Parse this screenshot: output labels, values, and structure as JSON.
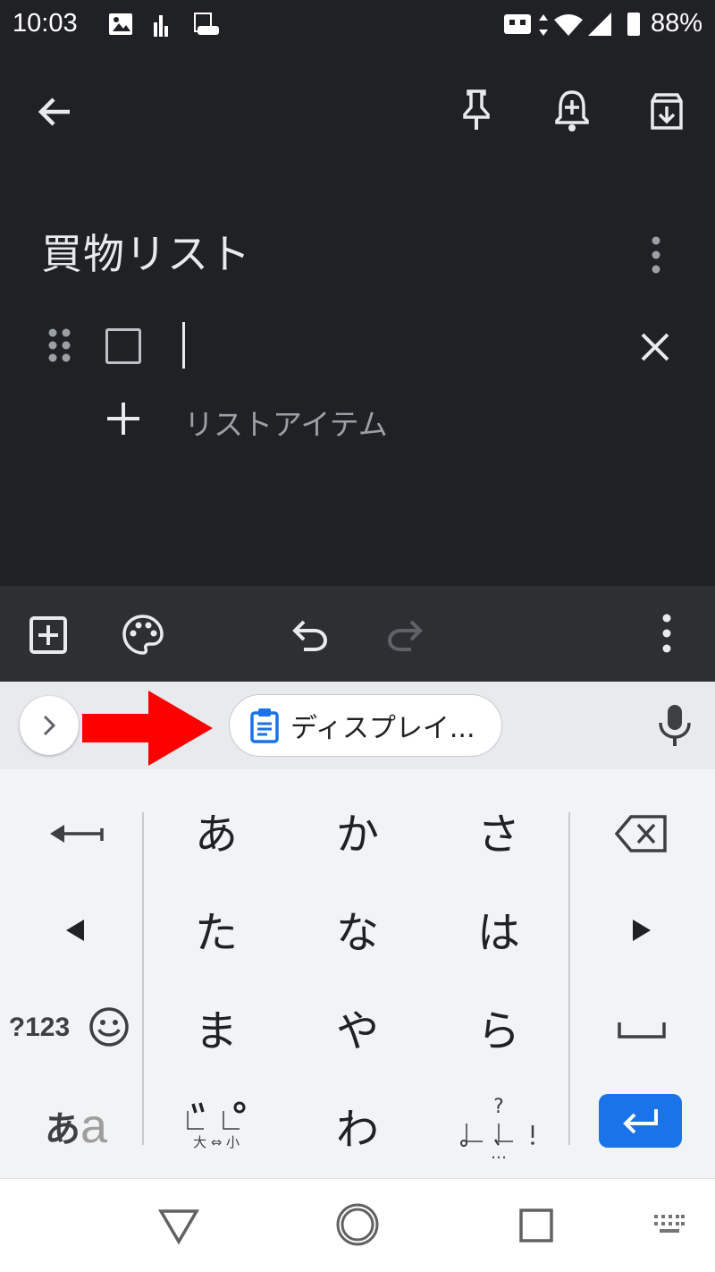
{
  "status_bar": {
    "time": "10:03",
    "battery": "88%"
  },
  "note": {
    "title": "買物リスト",
    "add_item_label": "リストアイテム"
  },
  "keyboard": {
    "suggestion": "ディスプレイ...",
    "keys": {
      "row1": [
        "あ",
        "か",
        "さ"
      ],
      "row2": [
        "た",
        "な",
        "は"
      ],
      "row3": [
        "ま",
        "や",
        "ら"
      ],
      "row4_center": "わ",
      "numeric_label": "?123",
      "mode_label_a": "あ",
      "mode_label_b": "a",
      "dakuten_caption": "大 ⇔ 小",
      "punct_top": "?",
      "punct_bottom": "…"
    }
  },
  "colors": {
    "accent": "#1a73e8",
    "arrow": "#ff0000",
    "dark_bg": "#202124"
  }
}
